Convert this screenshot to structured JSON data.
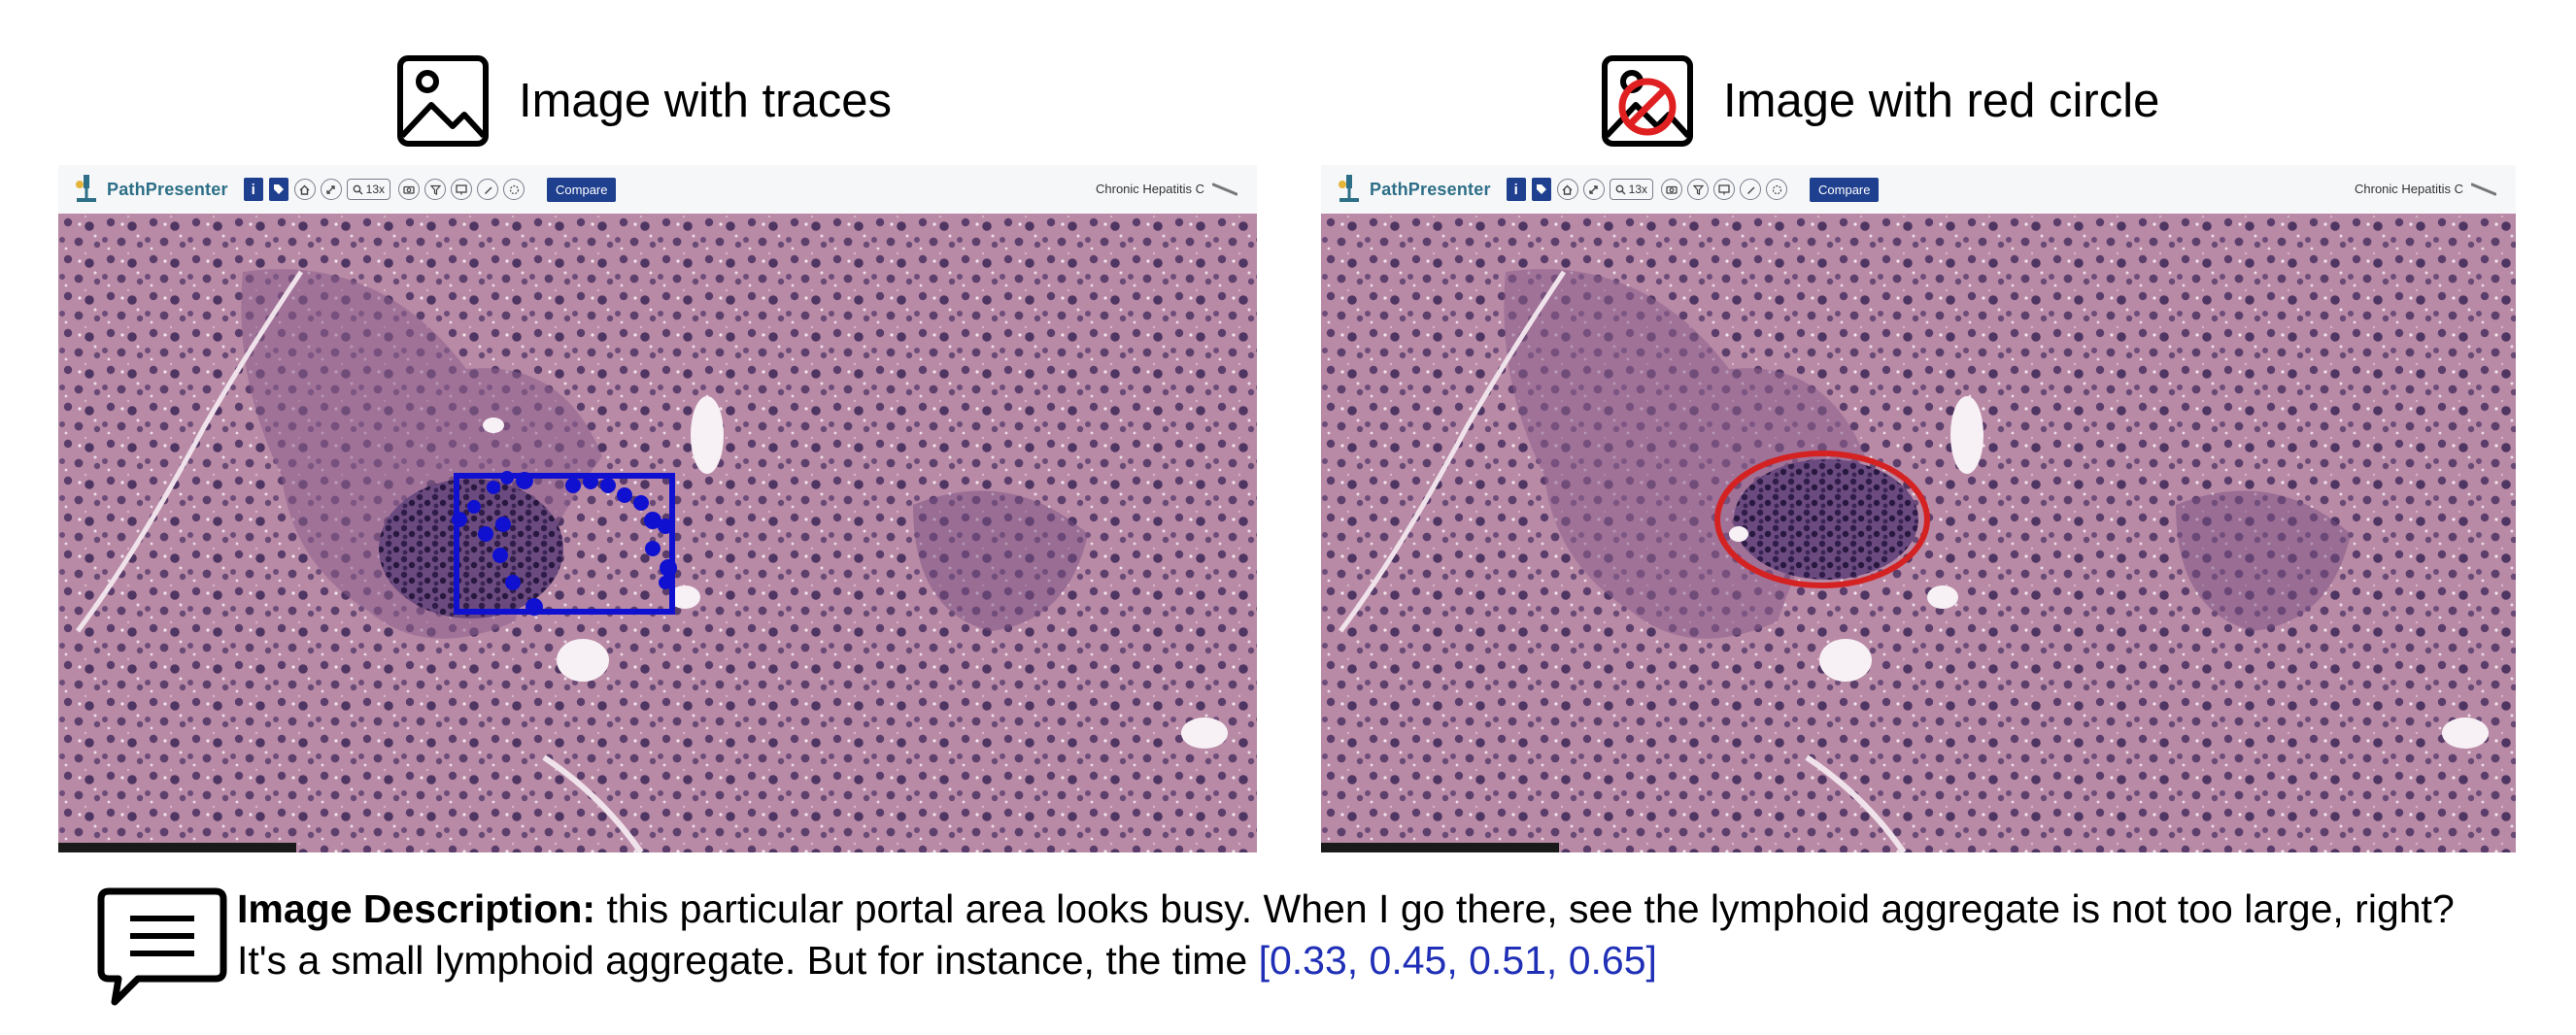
{
  "panels": {
    "left": {
      "title": "Image with traces",
      "title_icon": "image-icon",
      "annotation": {
        "type": "bounding-box-with-trace-dots",
        "color": "#1010d0"
      }
    },
    "right": {
      "title": "Image with red circle",
      "title_icon": "image-with-red-circle-icon",
      "annotation": {
        "type": "ellipse",
        "color": "#d42222"
      }
    }
  },
  "viewer": {
    "brand": "PathPresenter",
    "info_label": "i",
    "zoom_label": "13x",
    "compare_label": "Compare",
    "case_title": "Chronic Hepatitis C",
    "toolbar_icons": [
      "home-icon",
      "expand-icon",
      "zoom-icon",
      "camera-icon",
      "filter-icon",
      "monitor-icon",
      "pen-icon",
      "circle-icon"
    ]
  },
  "description": {
    "label": "Image Description:",
    "text": " this particular portal area looks busy. When I go there, see the lymphoid aggregate is not too large, right? It's a small lymphoid aggregate. But for instance, the time ",
    "coordinates": "[0.33, 0.45, 0.51, 0.65]",
    "icon": "speech-bubble-icon",
    "coordinate_color": "#1f2fb6"
  }
}
